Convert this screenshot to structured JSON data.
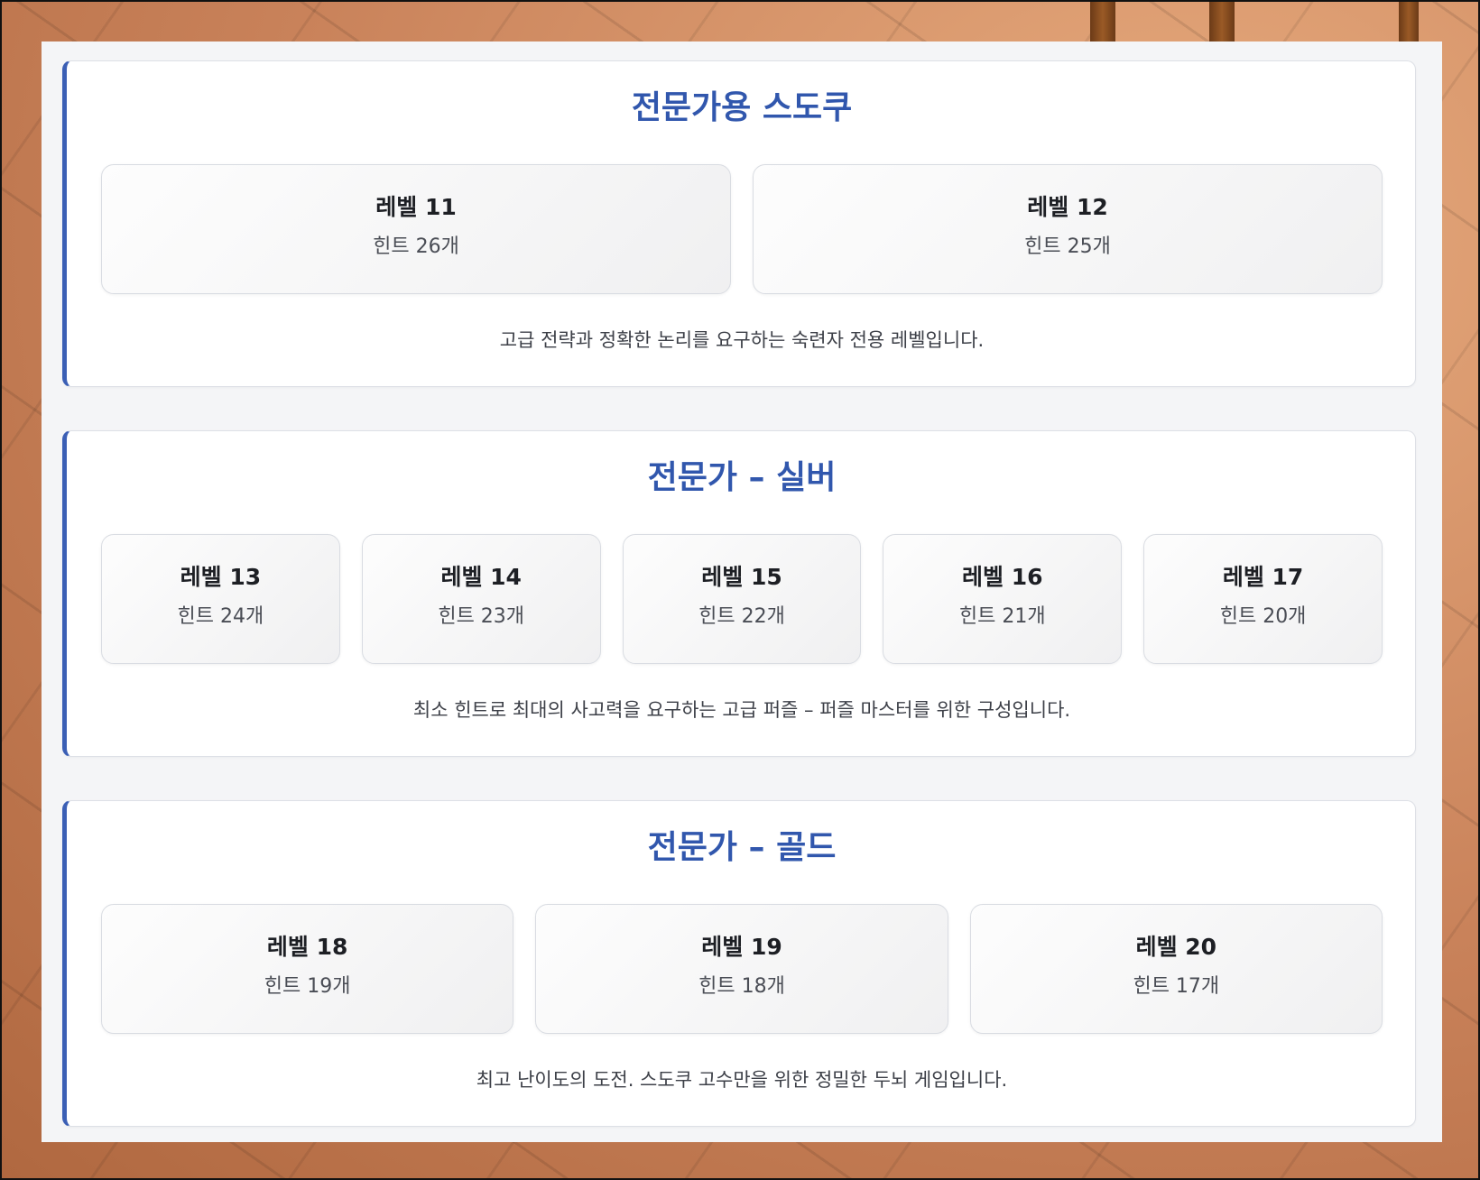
{
  "sections": [
    {
      "title": "전문가용 스도쿠",
      "levels": [
        {
          "name": "레벨 11",
          "hints": "힌트 26개"
        },
        {
          "name": "레벨 12",
          "hints": "힌트 25개"
        }
      ],
      "description": "고급 전략과 정확한 논리를 요구하는 숙련자 전용 레벨입니다."
    },
    {
      "title": "전문가 – 실버",
      "levels": [
        {
          "name": "레벨 13",
          "hints": "힌트 24개"
        },
        {
          "name": "레벨 14",
          "hints": "힌트 23개"
        },
        {
          "name": "레벨 15",
          "hints": "힌트 22개"
        },
        {
          "name": "레벨 16",
          "hints": "힌트 21개"
        },
        {
          "name": "레벨 17",
          "hints": "힌트 20개"
        }
      ],
      "description": "최소 힌트로 최대의 사고력을 요구하는 고급 퍼즐 – 퍼즐 마스터를 위한 구성입니다."
    },
    {
      "title": "전문가 – 골드",
      "levels": [
        {
          "name": "레벨 18",
          "hints": "힌트 19개"
        },
        {
          "name": "레벨 19",
          "hints": "힌트 18개"
        },
        {
          "name": "레벨 20",
          "hints": "힌트 17개"
        }
      ],
      "description": "최고 난이도의 도전. 스도쿠 고수만을 위한 정밀한 두뇌 게임입니다."
    }
  ],
  "colors": {
    "accent": "#3b5fb5",
    "title": "#3157ad",
    "panel_bg": "#f4f5f7",
    "card_bg": "#ffffff"
  }
}
